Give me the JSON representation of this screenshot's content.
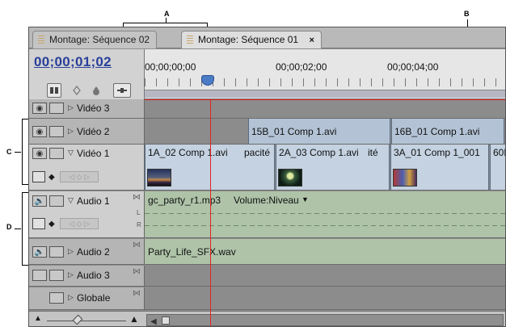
{
  "callouts": {
    "a": "A",
    "b": "B",
    "c": "C",
    "d": "D"
  },
  "tabs": [
    {
      "label": "Montage: Séquence 02",
      "active": false
    },
    {
      "label": "Montage: Séquence 01",
      "active": true,
      "close": "×"
    }
  ],
  "timecode": "00;00;01;02",
  "ruler": {
    "labels": [
      "00;00;00;00",
      "00;00;02;00",
      "00;00;04;00"
    ]
  },
  "tracks": {
    "video3": "Vidéo 3",
    "video2": "Vidéo 2",
    "video1": "Vidéo 1",
    "audio1": "Audio 1",
    "audio2": "Audio 2",
    "audio3": "Audio 3",
    "master": "Globale"
  },
  "clips": {
    "v2_a": "15B_01 Comp 1.avi",
    "v2_b": "16B_01 Comp 1.avi",
    "v1_a": "1A_02 Comp 1.avi",
    "v1_a_effect": "pacité",
    "v1_b": "2A_03 Comp 1.avi",
    "v1_b_effect": "ité",
    "v1_c": "3A_01 Comp 1_001",
    "v1_d": "60E",
    "a1": "gc_party_r1.mp3",
    "a1_effect": "Volume:Niveau",
    "a2": "Party_Life_SFX.wav"
  },
  "audio_channels": {
    "left": "L",
    "right": "R"
  },
  "colors": {
    "timecode": "#2a3f9a",
    "playhead": "#e32424",
    "video_clip": "#b3c3d5",
    "audio_clip": "#aec3a8",
    "panel_bg": "#8e8e8e"
  },
  "icons": {
    "snap": "snap-icon",
    "marker": "marker-icon",
    "keyframe": "keyframe-icon",
    "eye": "eye-icon",
    "speaker": "speaker-icon"
  }
}
